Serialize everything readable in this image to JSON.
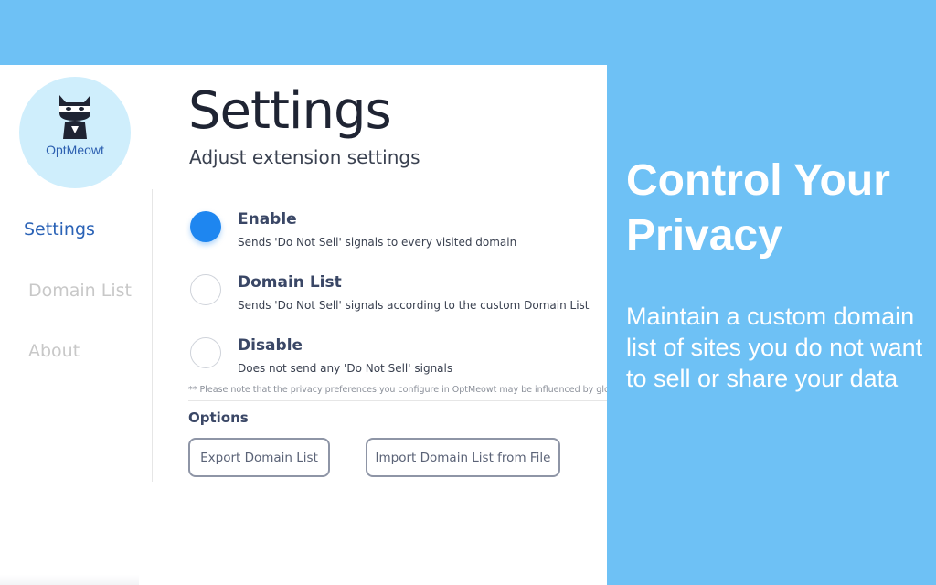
{
  "logo": {
    "name": "OptMeowt",
    "icon": "cat-icon"
  },
  "nav": {
    "items": [
      {
        "label": "Settings",
        "active": true
      },
      {
        "label": "Domain List",
        "active": false
      },
      {
        "label": "About",
        "active": false
      }
    ]
  },
  "header": {
    "title": "Settings",
    "subtitle": "Adjust extension settings"
  },
  "modes": [
    {
      "label": "Enable",
      "description": "Sends 'Do Not Sell' signals to every visited domain",
      "selected": true
    },
    {
      "label": "Domain List",
      "description": "Sends 'Do Not Sell' signals according to the custom Domain List",
      "selected": false
    },
    {
      "label": "Disable",
      "description": "Does not send any 'Do Not Sell' signals",
      "selected": false
    }
  ],
  "note": "** Please note that the privacy preferences you configure in OptMeowt may be influenced by glob",
  "options": {
    "heading": "Options",
    "export_label": "Export Domain List",
    "import_label": "Import Domain List from File"
  },
  "promo": {
    "heading": "Control Your Privacy",
    "text": "Maintain a custom domain list of sites you do not want to sell or share your data"
  },
  "colors": {
    "background": "#6ec1f5",
    "accent": "#1e86f0",
    "nav_active": "#2a62b6",
    "logo_bg": "#cfeefc"
  }
}
